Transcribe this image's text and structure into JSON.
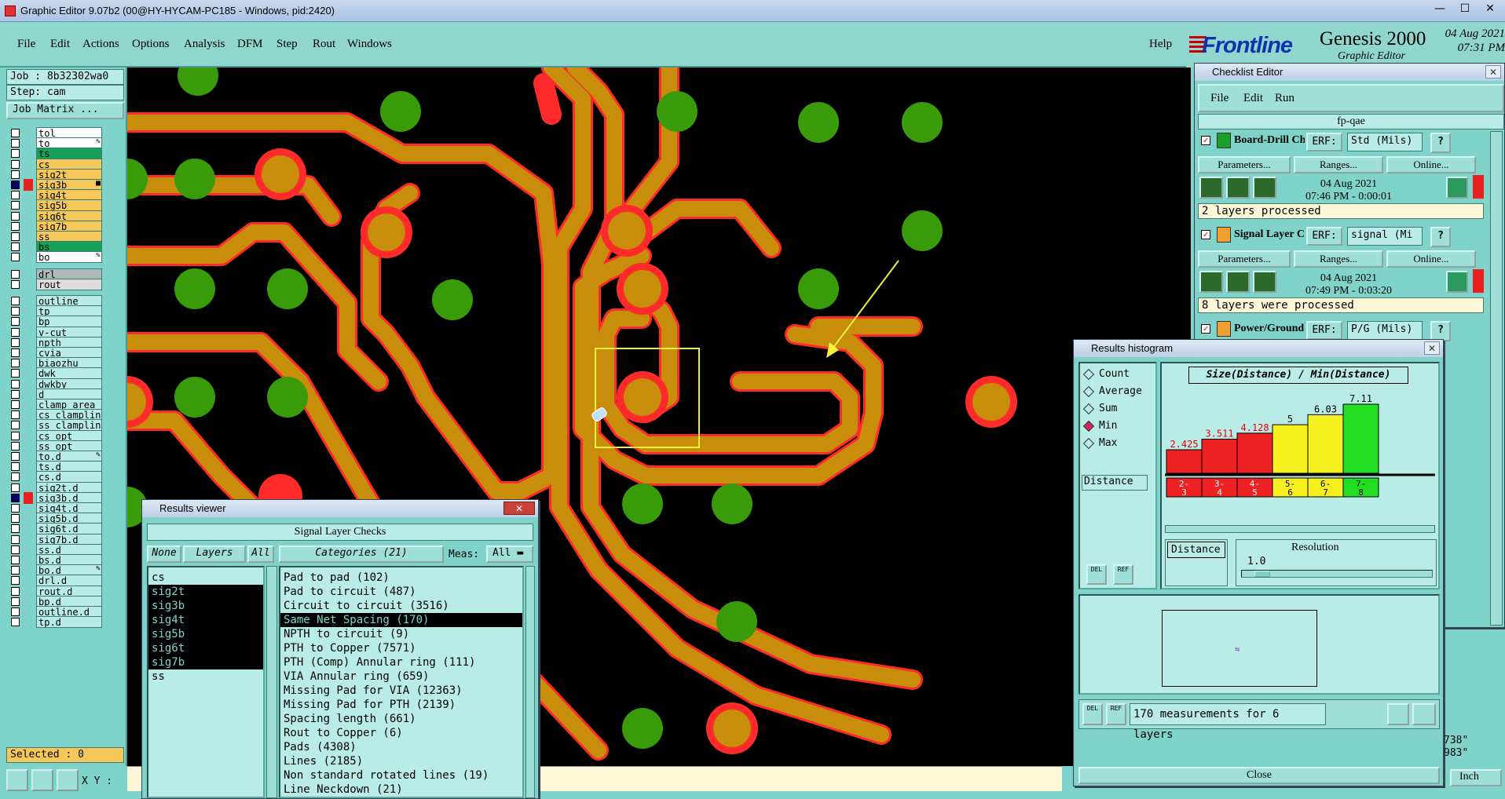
{
  "window": {
    "title": "Graphic Editor 9.07b2 (00@HY-HYCAM-PC185 - Windows, pid:2420)",
    "min": "—",
    "max": "☐",
    "close": "✕"
  },
  "menu": [
    "File",
    "Edit",
    "Actions",
    "Options",
    "Analysis",
    "DFM",
    "Step",
    "Rout",
    "Windows"
  ],
  "help": "Help",
  "brand": {
    "logo": "Frontline",
    "product": "Genesis 2000",
    "subtitle": "Graphic Editor",
    "date": "04 Aug 2021",
    "time": "07:31 PM"
  },
  "left": {
    "job": "Job : 8b32302wa0",
    "step": "Step: cam",
    "job_matrix": "Job Matrix ...",
    "selected": "Selected : 0",
    "xy_label": "X Y :",
    "layers_board": [
      {
        "name": "tol",
        "color": "#ffffff",
        "mark": ""
      },
      {
        "name": "to",
        "color": "#ffffff",
        "mark": "✎"
      },
      {
        "name": "ts",
        "color": "#16a05a",
        "mark": ""
      },
      {
        "name": "cs",
        "color": "#f6c85a",
        "mark": ""
      },
      {
        "name": "sig2t",
        "color": "#f6c85a",
        "mark": ""
      },
      {
        "name": "sig3b",
        "color": "#f6c85a",
        "mark": "■",
        "active": true
      },
      {
        "name": "sig4t",
        "color": "#f6c85a",
        "mark": ""
      },
      {
        "name": "sig5b",
        "color": "#f6c85a",
        "mark": ""
      },
      {
        "name": "sig6t",
        "color": "#f6c85a",
        "mark": ""
      },
      {
        "name": "sig7b",
        "color": "#f6c85a",
        "mark": ""
      },
      {
        "name": "ss",
        "color": "#f6c85a",
        "mark": ""
      },
      {
        "name": "bs",
        "color": "#16a05a",
        "mark": ""
      },
      {
        "name": "bo",
        "color": "#ffffff",
        "mark": "✎"
      }
    ],
    "layers_drill": [
      {
        "name": "drl",
        "color": "#aeb8b8"
      },
      {
        "name": "rout",
        "color": "#dcdcdc"
      }
    ],
    "layers_misc": [
      {
        "name": "outline",
        "mark": ""
      },
      {
        "name": "tp",
        "mark": ""
      },
      {
        "name": "bp",
        "mark": ""
      },
      {
        "name": "v-cut",
        "mark": ""
      },
      {
        "name": "npth",
        "mark": ""
      },
      {
        "name": "cvia",
        "mark": ""
      },
      {
        "name": "biaozhu",
        "mark": ""
      },
      {
        "name": "dwk",
        "mark": ""
      },
      {
        "name": "dwkby",
        "mark": ""
      },
      {
        "name": "d",
        "mark": ""
      },
      {
        "name": "clamp_area",
        "mark": ""
      },
      {
        "name": "cs_clampline",
        "mark": ""
      },
      {
        "name": "ss_clampline",
        "mark": ""
      },
      {
        "name": "cs_opt",
        "mark": ""
      },
      {
        "name": "ss_opt",
        "mark": ""
      },
      {
        "name": "to.d",
        "mark": "✎"
      },
      {
        "name": "ts.d",
        "mark": ""
      },
      {
        "name": "cs.d",
        "mark": ""
      },
      {
        "name": "sig2t.d",
        "mark": ""
      },
      {
        "name": "sig3b.d",
        "mark": "",
        "active": true
      },
      {
        "name": "sig4t.d",
        "mark": ""
      },
      {
        "name": "sig5b.d",
        "mark": ""
      },
      {
        "name": "sig6t.d",
        "mark": ""
      },
      {
        "name": "sig7b.d",
        "mark": ""
      },
      {
        "name": "ss.d",
        "mark": ""
      },
      {
        "name": "bs.d",
        "mark": ""
      },
      {
        "name": "bo.d",
        "mark": "✎"
      },
      {
        "name": "drl.d",
        "mark": ""
      },
      {
        "name": "rout.d",
        "mark": ""
      },
      {
        "name": "bp.d",
        "mark": ""
      },
      {
        "name": "outline.d",
        "mark": ""
      },
      {
        "name": "tp.d",
        "mark": ""
      }
    ]
  },
  "checklist": {
    "title": "Checklist Editor",
    "menu": [
      "File",
      "Edit",
      "Run"
    ],
    "name": "fp-qae",
    "checks": [
      {
        "name": "Board-Drill Che",
        "erf_label": "ERF:",
        "erf": "Std (Mils)",
        "help": "?",
        "params": "Parameters...",
        "ranges": "Ranges...",
        "online": "Online...",
        "date": "04 Aug 2021",
        "time": "07:46 PM - 0:00:01",
        "status": "2 layers processed"
      },
      {
        "name": "Signal Layer Ch",
        "erf_label": "ERF:",
        "erf": "signal (Mi",
        "help": "?",
        "params": "Parameters...",
        "ranges": "Ranges...",
        "online": "Online...",
        "date": "04 Aug 2021",
        "time": "07:49 PM - 0:03:20",
        "status": "8 layers were processed"
      },
      {
        "name": "Power/Ground C",
        "erf_label": "ERF:",
        "erf": "P/G (Mils)",
        "help": "?"
      }
    ]
  },
  "histogram": {
    "title": "Results histogram",
    "options": [
      {
        "label": "Count",
        "selected": false
      },
      {
        "label": "Average",
        "selected": false
      },
      {
        "label": "Sum",
        "selected": false
      },
      {
        "label": "Min",
        "selected": true
      },
      {
        "label": "Max",
        "selected": false
      }
    ],
    "distance": "Distance",
    "chart_title": "Size(Distance) / Min(Distance)",
    "distance2": "Distance",
    "resolution_label": "Resolution",
    "resolution": "1.0",
    "status": "170 measurements for 6 layers",
    "close": "Close",
    "del": "DEL",
    "ref": "REF"
  },
  "chart_data": {
    "type": "bar",
    "title": "Size(Distance) / Min(Distance)",
    "categories": [
      "2-3",
      "3-4",
      "4-5",
      "5-6",
      "6-7",
      "7-8"
    ],
    "values": [
      2.425,
      3.511,
      4.128,
      5,
      6.03,
      7.11
    ],
    "value_labels": [
      "2.425",
      "3.511",
      "4.128",
      "5",
      "6.03",
      "7.11"
    ],
    "colors": [
      "#ee2222",
      "#ee2222",
      "#ee2222",
      "#f6f020",
      "#f6f020",
      "#22dd22"
    ],
    "ylim": [
      0,
      7.11
    ]
  },
  "results": {
    "title": "Results viewer",
    "check_name": "Signal Layer Checks",
    "none": "None",
    "layers": "Layers",
    "all": "All",
    "categories": "Categories (21)",
    "meas_label": "Meas:",
    "meas": "All",
    "layer_list": [
      {
        "name": "cs",
        "sel": false
      },
      {
        "name": "sig2t",
        "sel": true
      },
      {
        "name": "sig3b",
        "sel": true
      },
      {
        "name": "sig4t",
        "sel": true
      },
      {
        "name": "sig5b",
        "sel": true
      },
      {
        "name": "sig6t",
        "sel": true
      },
      {
        "name": "sig7b",
        "sel": true
      },
      {
        "name": "ss",
        "sel": false
      }
    ],
    "category_list": [
      {
        "name": "Pad to pad (102)",
        "sel": false
      },
      {
        "name": "Pad to circuit (487)",
        "sel": false
      },
      {
        "name": "Circuit to circuit (3516)",
        "sel": false
      },
      {
        "name": "Same Net Spacing (170)",
        "sel": true
      },
      {
        "name": "NPTH to circuit (9)",
        "sel": false
      },
      {
        "name": "PTH to Copper (7571)",
        "sel": false
      },
      {
        "name": "PTH (Comp) Annular ring (111)",
        "sel": false
      },
      {
        "name": "VIA Annular ring (659)",
        "sel": false
      },
      {
        "name": "Missing Pad for VIA (12363)",
        "sel": false
      },
      {
        "name": "Missing Pad for PTH (2139)",
        "sel": false
      },
      {
        "name": "Spacing length (661)",
        "sel": false
      },
      {
        "name": "Rout to Copper (6)",
        "sel": false
      },
      {
        "name": "Pads (4308)",
        "sel": false
      },
      {
        "name": "Lines (2185)",
        "sel": false
      },
      {
        "name": "Non standard rotated lines (19)",
        "sel": false
      },
      {
        "name": "Line Neckdown (21)",
        "sel": false
      }
    ]
  },
  "coords": {
    "x": "738\"",
    "y": "983\""
  },
  "units": "Inch"
}
